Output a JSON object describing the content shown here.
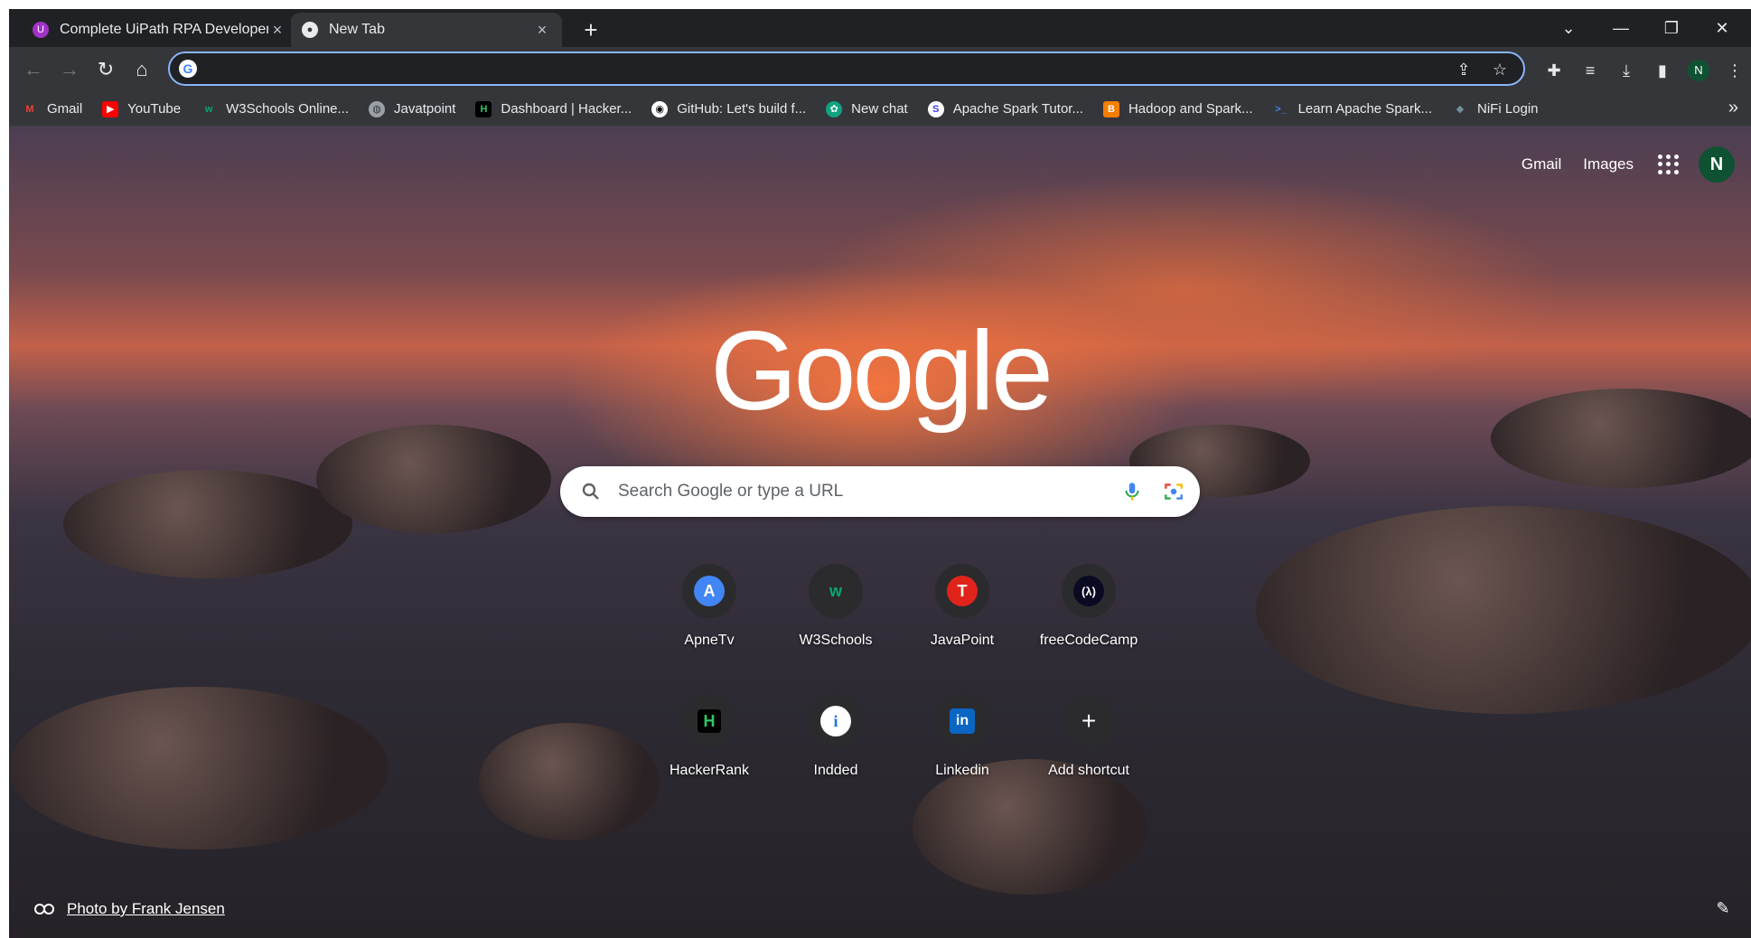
{
  "tabs": [
    {
      "title": "Complete UiPath RPA Developer",
      "favicon": "uipath-icon",
      "close": "×"
    },
    {
      "title": "New Tab",
      "favicon": "chrome-icon",
      "close": "×"
    }
  ],
  "tabstrip": {
    "new_tab": "+",
    "tab_search": "⌄",
    "minimize": "—",
    "restore": "❐",
    "close": "✕"
  },
  "toolbar": {
    "back": "←",
    "forward": "→",
    "reload": "↻",
    "home": "⌂",
    "omnibox_value": "",
    "share": "⇪",
    "bookmark_star": "☆",
    "extensions": "✚",
    "media": "≡",
    "downloads": "⤓",
    "side_panel": "▮",
    "profile_initial": "N",
    "menu": "⋮"
  },
  "bookmarks": [
    {
      "label": "Gmail",
      "icon": "gmail-icon",
      "color": "#ea4335"
    },
    {
      "label": "YouTube",
      "icon": "youtube-icon",
      "color": "#ff0000"
    },
    {
      "label": "W3Schools Online...",
      "icon": "w3schools-icon",
      "color": "#04aa6d"
    },
    {
      "label": "Javatpoint",
      "icon": "globe-icon",
      "color": "#9aa0a6"
    },
    {
      "label": "Dashboard | Hacker...",
      "icon": "hackerrank-icon",
      "color": "#000000"
    },
    {
      "label": "GitHub: Let's build f...",
      "icon": "github-icon",
      "color": "#ffffff"
    },
    {
      "label": "New chat",
      "icon": "chatgpt-icon",
      "color": "#10a37f"
    },
    {
      "label": "Apache Spark Tutor...",
      "icon": "spark-icon",
      "color": "#3c3cff"
    },
    {
      "label": "Hadoop and Spark...",
      "icon": "blogger-icon",
      "color": "#f57d00"
    },
    {
      "label": "Learn Apache Spark...",
      "icon": "terminal-icon",
      "color": "#4285f4"
    },
    {
      "label": "NiFi Login",
      "icon": "nifi-icon",
      "color": "#728e9b"
    }
  ],
  "bookmarks_more": "»",
  "ntp": {
    "gmail_link": "Gmail",
    "images_link": "Images",
    "avatar_initial": "N",
    "logo": "Google",
    "search_placeholder": "Search Google or type a URL",
    "shortcuts": [
      {
        "label": "ApneTv",
        "icon": "apnetv-icon",
        "glyph": "A",
        "color": "#4285f4"
      },
      {
        "label": "W3Schools",
        "icon": "w3schools-icon",
        "glyph": "w",
        "color": "#04aa6d"
      },
      {
        "label": "JavaPoint",
        "icon": "javapoint-icon",
        "glyph": "T",
        "color": "#e0241b"
      },
      {
        "label": "freeCodeCamp",
        "icon": "freecodecamp-icon",
        "glyph": "(λ)",
        "color": "#0a0a23"
      },
      {
        "label": "HackerRank",
        "icon": "hackerrank-icon",
        "glyph": "H",
        "color": "#000000"
      },
      {
        "label": "Indded",
        "icon": "info-icon",
        "glyph": "i",
        "color": "#ffffff"
      },
      {
        "label": "Linkedin",
        "icon": "linkedin-icon",
        "glyph": "in",
        "color": "#0a66c2"
      },
      {
        "label": "Add shortcut",
        "icon": "plus-icon",
        "glyph": "+",
        "color": "#3c3c3f"
      }
    ],
    "attribution": "Photo by Frank Jensen",
    "customize": "✎"
  }
}
